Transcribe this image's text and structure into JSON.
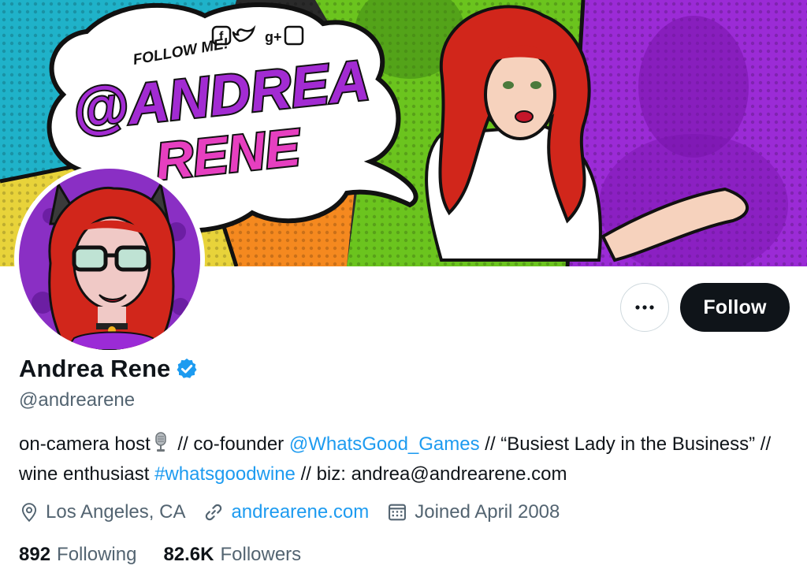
{
  "banner": {
    "follow_text": "FOLLOW ME!",
    "title_line1": "@ANDREA",
    "title_line2": "RENE",
    "social_icons": [
      "facebook-icon",
      "twitter-icon",
      "google-plus-icon",
      "twitch-icon"
    ],
    "colors": {
      "cyan": "#1fb2c9",
      "green": "#6bc41e",
      "purple": "#9b2bd6",
      "orange": "#f5891f",
      "yellow": "#f3e43a",
      "magenta": "#c92bd6"
    }
  },
  "profile": {
    "display_name": "Andrea Rene",
    "handle": "@andrearene",
    "verified_icon": "verified-badge-icon",
    "bio": {
      "part1": "on-camera host",
      "mic_icon": "microphone-icon",
      "part2": " // co-founder ",
      "mention": "@WhatsGood_Games",
      "part3": " // “Busiest Lady in the Business” // wine enthusiast ",
      "hashtag": "#whatsgoodwine",
      "part4": " // biz: andrea@andrearene.com"
    },
    "location": "Los Angeles, CA",
    "website": "andrearene.com",
    "joined": "Joined April 2008",
    "following_count": "892",
    "following_label": "Following",
    "followers_count": "82.6K",
    "followers_label": "Followers"
  },
  "actions": {
    "more_icon": "more-dots-icon",
    "follow_label": "Follow"
  },
  "theme": {
    "link_color": "#1d9bf0",
    "text_primary": "#0f1419",
    "text_secondary": "#536471",
    "button_dark": "#0f1419"
  }
}
